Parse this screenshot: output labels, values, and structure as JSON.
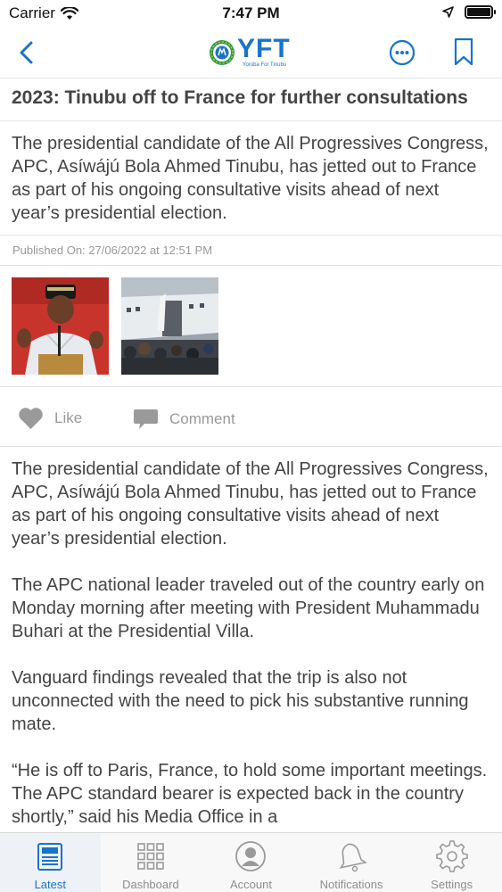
{
  "status_bar": {
    "carrier": "Carrier",
    "time": "7:47 PM"
  },
  "nav": {
    "logo_text": "YFT",
    "logo_tagline": "Yorùbá For Tinubu"
  },
  "article": {
    "title": "2023: Tinubu off to France for further consultations",
    "summary": "The presidential candidate of the All Progressives Congress, APC, Asíwájú Bola Ahmed Tinubu, has jetted out to France as part of his ongoing consultative visits ahead of next year’s presidential election.",
    "published": "Published On: 27/06/2022 at 12:51 PM",
    "body": [
      "The presidential candidate of the All Progressives Congress, APC, Asíwájú Bola Ahmed Tinubu, has jetted out to France as part of his ongoing consultative visits ahead of next year’s presidential election.",
      "The APC national leader traveled out of the country early on Monday morning after meeting with President Muhammadu Buhari at the Presidential Villa.",
      "Vanguard findings revealed that the trip is also not unconnected with the need to pick his substantive running mate.",
      "“He is off to Paris, France, to hold some important meetings. The APC standard bearer is expected back in the country shortly,” said his Media Office in a"
    ]
  },
  "actions": {
    "like_label": "Like",
    "comment_label": "Comment"
  },
  "tabs": [
    {
      "label": "Latest",
      "icon": "newspaper-icon",
      "active": true
    },
    {
      "label": "Dashboard",
      "icon": "grid-icon",
      "active": false
    },
    {
      "label": "Account",
      "icon": "person-icon",
      "active": false
    },
    {
      "label": "Notifications",
      "icon": "bell-icon",
      "active": false
    },
    {
      "label": "Settings",
      "icon": "gear-icon",
      "active": false
    }
  ],
  "colors": {
    "accent": "#1a73c9",
    "muted": "#9a9a9a",
    "text": "#444444",
    "divider": "#e4e4e4"
  }
}
